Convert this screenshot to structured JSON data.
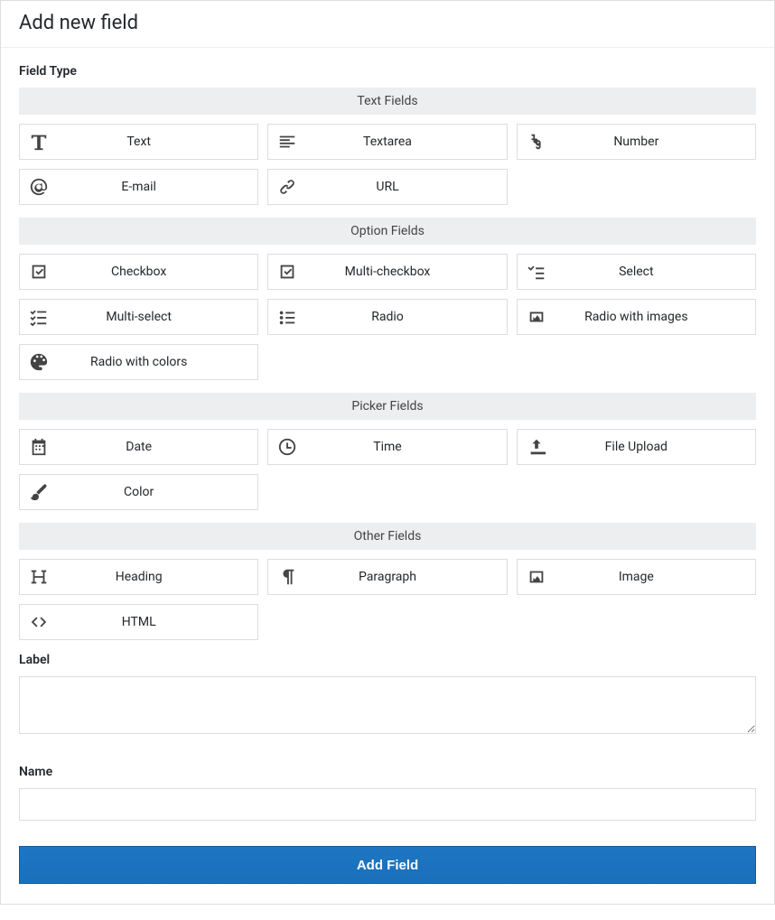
{
  "header": {
    "title": "Add new field"
  },
  "fieldTypeLabel": "Field Type",
  "groups": [
    {
      "header": "Text Fields",
      "tiles": [
        {
          "name": "text",
          "icon": "font-icon",
          "label": "Text"
        },
        {
          "name": "textarea",
          "icon": "align-left-icon",
          "label": "Textarea"
        },
        {
          "name": "number",
          "icon": "one-nine-icon",
          "label": "Number"
        },
        {
          "name": "email",
          "icon": "at-icon",
          "label": "E-mail"
        },
        {
          "name": "url",
          "icon": "link-icon",
          "label": "URL"
        }
      ]
    },
    {
      "header": "Option Fields",
      "tiles": [
        {
          "name": "checkbox",
          "icon": "check-square-icon",
          "label": "Checkbox"
        },
        {
          "name": "multi-checkbox",
          "icon": "check-square-icon",
          "label": "Multi-checkbox"
        },
        {
          "name": "select",
          "icon": "check-list-icon",
          "label": "Select"
        },
        {
          "name": "multi-select",
          "icon": "list-check-icon",
          "label": "Multi-select"
        },
        {
          "name": "radio",
          "icon": "list-dot-icon",
          "label": "Radio"
        },
        {
          "name": "radio-with-images",
          "icon": "images-icon",
          "label": "Radio with images"
        },
        {
          "name": "radio-with-colors",
          "icon": "palette-icon",
          "label": "Radio with colors"
        }
      ]
    },
    {
      "header": "Picker Fields",
      "tiles": [
        {
          "name": "date",
          "icon": "calendar-icon",
          "label": "Date"
        },
        {
          "name": "time",
          "icon": "clock-icon",
          "label": "Time"
        },
        {
          "name": "file-upload",
          "icon": "upload-icon",
          "label": "File Upload"
        },
        {
          "name": "color",
          "icon": "brush-icon",
          "label": "Color"
        }
      ]
    },
    {
      "header": "Other Fields",
      "tiles": [
        {
          "name": "heading",
          "icon": "heading-icon",
          "label": "Heading"
        },
        {
          "name": "paragraph",
          "icon": "pilcrow-icon",
          "label": "Paragraph"
        },
        {
          "name": "image",
          "icon": "image-icon",
          "label": "Image"
        },
        {
          "name": "html",
          "icon": "code-icon",
          "label": "HTML"
        }
      ]
    }
  ],
  "labelField": {
    "label": "Label",
    "value": ""
  },
  "nameField": {
    "label": "Name",
    "value": ""
  },
  "submit": "Add Field",
  "colors": {
    "primary": "#1a6fba"
  }
}
